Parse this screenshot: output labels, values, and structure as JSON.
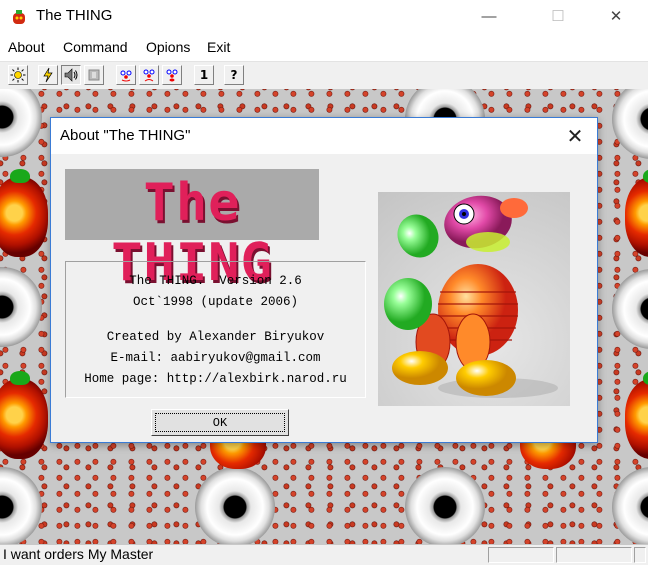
{
  "window": {
    "title": "The THING",
    "minimize_glyph": "—",
    "maximize_glyph": "☐",
    "close_glyph": "✕"
  },
  "menu": [
    "About",
    "Command",
    "Opions",
    "Exit"
  ],
  "toolbar": {
    "icons": [
      "sun-icon",
      "lightning-icon",
      "speaker-icon",
      "stop-icon",
      "clown-face-1-icon",
      "clown-face-2-icon",
      "clown-face-3-icon",
      "number-one-icon",
      "help-icon"
    ],
    "number_label": "1",
    "help_label": "?"
  },
  "dialog": {
    "title": "About \"The THING\"",
    "close_glyph": "✕",
    "logo_text": "The THING",
    "info_lines": [
      "The THING.  Version 2.6",
      "Oct`1998 (update 2006)",
      "Created by Alexander Biryukov",
      "E-mail: aabiryukov@gmail.com",
      "Home page: http://alexbirk.narod.ru"
    ],
    "ok_label": "OK"
  },
  "status": {
    "text": "I want orders My Master"
  },
  "colors": {
    "accent_border": "#3a7bd5",
    "logo_pink": "#e0205a",
    "background_dots": "#c8c8c8"
  }
}
